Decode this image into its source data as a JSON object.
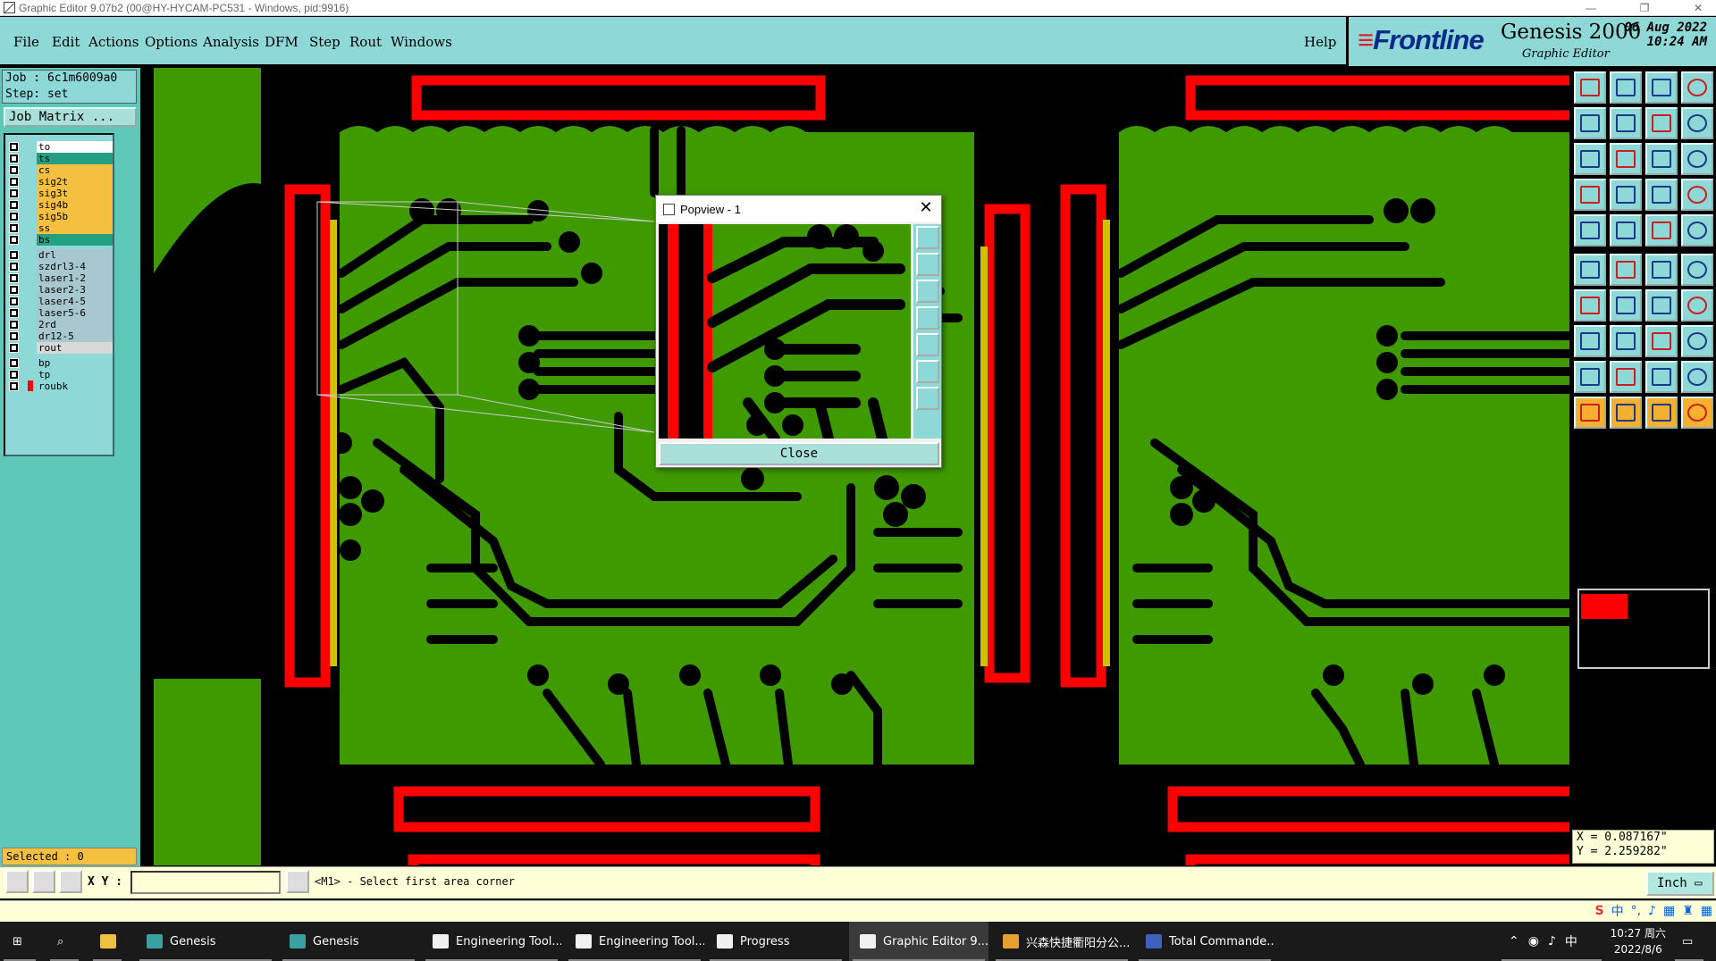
{
  "window": {
    "title": "Graphic Editor 9.07b2 (00@HY-HYCAM-PC531 - Windows, pid:9916)"
  },
  "menu": {
    "items": [
      {
        "label": "File"
      },
      {
        "label": "Edit"
      },
      {
        "label": "Actions"
      },
      {
        "label": "Options"
      },
      {
        "label": "Analysis"
      },
      {
        "label": "DFM"
      },
      {
        "label": "Step"
      },
      {
        "label": "Rout"
      },
      {
        "label": "Windows"
      }
    ],
    "help": "Help"
  },
  "brand": {
    "logo": "Frontline",
    "product": "Genesis 2000",
    "subtitle": "Graphic Editor",
    "date": "06 Aug 2022",
    "time": "10:24 AM"
  },
  "job": {
    "job_label": "Job : 6c1m6009a0",
    "step_label": "Step: set",
    "matrix_button": "Job Matrix ..."
  },
  "layers": [
    {
      "name": "to",
      "color": "#ffffff"
    },
    {
      "name": "ts",
      "color": "#22a080"
    },
    {
      "name": "cs",
      "color": "#f5c040"
    },
    {
      "name": "sig2t",
      "color": "#f5c040"
    },
    {
      "name": "sig3t",
      "color": "#f5c040"
    },
    {
      "name": "sig4b",
      "color": "#f5c040"
    },
    {
      "name": "sig5b",
      "color": "#f5c040"
    },
    {
      "name": "ss",
      "color": "#f5c040"
    },
    {
      "name": "bs",
      "color": "#22a080"
    },
    {
      "name": "drl",
      "color": "#a8c8d0"
    },
    {
      "name": "szdrl3-4",
      "color": "#a8c8d0"
    },
    {
      "name": "laser1-2",
      "color": "#a8c8d0"
    },
    {
      "name": "laser2-3",
      "color": "#a8c8d0"
    },
    {
      "name": "laser4-5",
      "color": "#a8c8d0"
    },
    {
      "name": "laser5-6",
      "color": "#a8c8d0"
    },
    {
      "name": "2rd",
      "color": "#a8c8d0"
    },
    {
      "name": "dr12-5",
      "color": "#a8c8d0"
    },
    {
      "name": "rout",
      "color": "#d8d8d8"
    },
    {
      "name": "bp",
      "color": "#8fd8d8"
    },
    {
      "name": "tp",
      "color": "#8fd8d8"
    },
    {
      "name": "roubk",
      "color": "#8fd8d8"
    }
  ],
  "selected": "Selected : 0",
  "coords": {
    "x": "X = 0.087167\"",
    "y": "Y = 2.259282\""
  },
  "status": {
    "xy_label": "X Y :",
    "xy_value": "",
    "hint": "<M1> - Select first area corner",
    "unit": "Inch"
  },
  "popview": {
    "title": "Popview - 1",
    "close_label": "Close"
  },
  "taskbar": {
    "items": [
      {
        "label": "Genesis",
        "icon": "#3aa0a0"
      },
      {
        "label": "Genesis",
        "icon": "#3aa0a0"
      },
      {
        "label": "Engineering Tool...",
        "icon": "#f0f0f0"
      },
      {
        "label": "Engineering Tool...",
        "icon": "#f0f0f0"
      },
      {
        "label": "Progress",
        "icon": "#f0f0f0"
      },
      {
        "label": "Graphic Editor 9....",
        "icon": "#f0f0f0"
      },
      {
        "label": "兴森快捷衢阳分公...",
        "icon": "#e8a030"
      },
      {
        "label": "Total Commande...",
        "icon": "#4060c0"
      }
    ],
    "time": "10:27 周六",
    "date": "2022/8/6",
    "ime": "中"
  },
  "colors": {
    "copper": "#3f9a00",
    "pad_outline": "#ff0000",
    "board": "#000000",
    "panel": "#8fd8d8"
  }
}
